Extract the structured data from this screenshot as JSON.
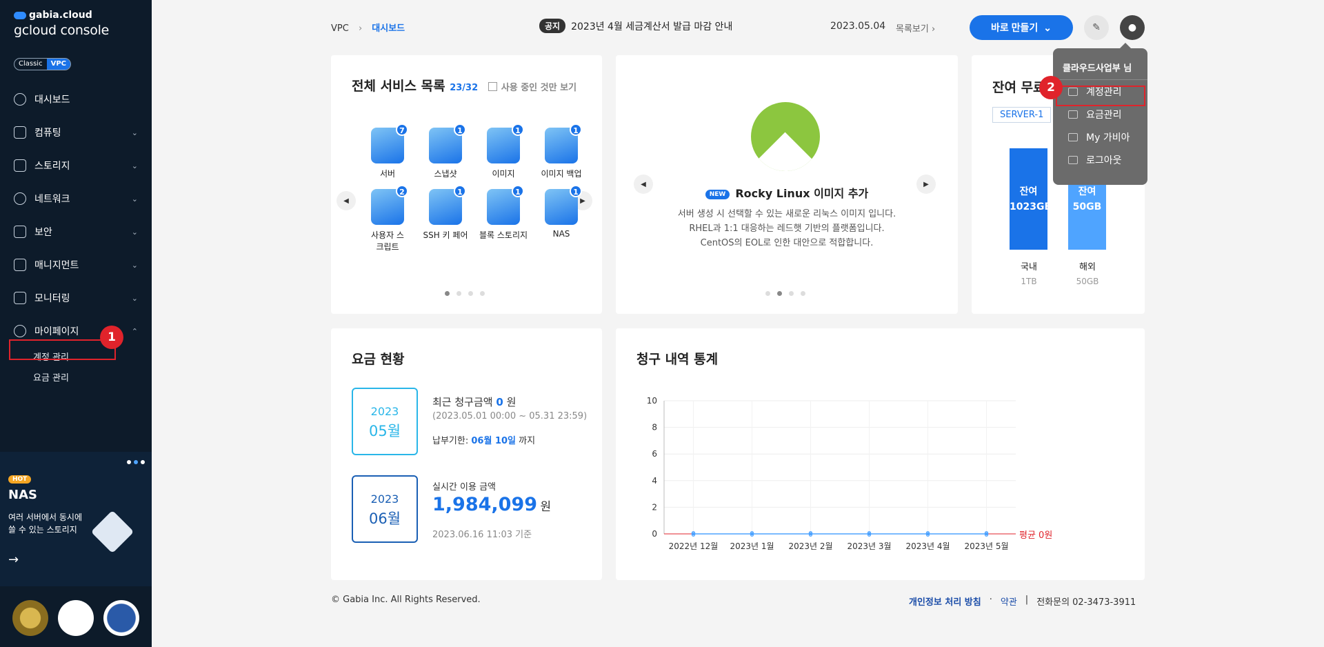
{
  "sidebar": {
    "brand_top": "gabia.cloud",
    "brand_main": "gcloud console",
    "switch": {
      "classic": "Classic",
      "vpc": "VPC"
    },
    "menu": [
      {
        "label": "대시보드"
      },
      {
        "label": "컴퓨팅"
      },
      {
        "label": "스토리지"
      },
      {
        "label": "네트워크"
      },
      {
        "label": "보안"
      },
      {
        "label": "매니지먼트"
      },
      {
        "label": "모니터링"
      },
      {
        "label": "마이페이지"
      }
    ],
    "submenu": [
      "계정 관리",
      "요금 관리"
    ],
    "promo": {
      "tag": "HOT",
      "title": "NAS",
      "desc": "여러 서버에서 동시에 쓸 수 있는 스토리지",
      "arrow": "→"
    }
  },
  "annotations": {
    "one": "1",
    "two": "2"
  },
  "header": {
    "breadcrumb_root": "VPC",
    "breadcrumb_sep": "›",
    "breadcrumb_current": "대시보드",
    "notice_tag": "공지",
    "notice_text": "2023년 4월 세금계산서 발급 마감 안내",
    "notice_date": "2023.05.04",
    "list_view": "목록보기 ›",
    "make_button": "바로 만들기",
    "make_chevron": "⌄"
  },
  "services": {
    "title": "전체 서비스 목록",
    "count": "23/32",
    "filter": "사용 중인 것만 보기",
    "items": [
      {
        "label": "서버",
        "badge": "7"
      },
      {
        "label": "스냅샷",
        "badge": "1"
      },
      {
        "label": "이미지",
        "badge": "1"
      },
      {
        "label": "이미지 백업",
        "badge": "1"
      },
      {
        "label": "사용자 스크립트",
        "badge": "2"
      },
      {
        "label": "SSH 키 페어",
        "badge": "1"
      },
      {
        "label": "블록 스토리지",
        "badge": "1"
      },
      {
        "label": "NAS",
        "badge": "1"
      }
    ]
  },
  "rocky": {
    "new": "NEW",
    "title": "Rocky Linux 이미지 추가",
    "desc1": "서버 생성 시 선택할 수 있는 새로운 리눅스 이미지 입니다.",
    "desc2": "RHEL과 1:1 대응하는 레드햇 기반의 플랫폼입니다.",
    "desc3": "CentOS의 EOL로 인한 대안으로 적합합니다."
  },
  "free": {
    "title": "잔여 무료",
    "server": "SERVER-1",
    "bars": [
      {
        "top": "잔여",
        "value": "1023GB",
        "label": "국내",
        "sub": "1TB"
      },
      {
        "top": "잔여",
        "value": "50GB",
        "label": "해외",
        "sub": "50GB"
      }
    ]
  },
  "dropdown": {
    "user": "클라우드사업부 님",
    "items": [
      "계정관리",
      "요금관리",
      "My 가비아",
      "로그아웃"
    ]
  },
  "fee": {
    "title": "요금 현황",
    "box1": {
      "year": "2023",
      "month": "05월"
    },
    "recent_label": "최근 청구금액",
    "recent_value": "0",
    "recent_unit": "원",
    "recent_period": "(2023.05.01 00:00 ~ 05.31 23:59)",
    "due_label": "납부기한:",
    "due_value": "06월 10일",
    "due_suffix": "까지",
    "box2": {
      "year": "2023",
      "month": "06월"
    },
    "realtime_label": "실시간 이용 금액",
    "realtime_value": "1,984,099",
    "realtime_unit": "원",
    "realtime_basis": "2023.06.16 11:03 기준"
  },
  "billing": {
    "title": "청구 내역 통계",
    "avg_label": "평균 0원"
  },
  "chart_data": {
    "type": "line",
    "categories": [
      "2022년 12월",
      "2023년 1월",
      "2023년 2월",
      "2023년 3월",
      "2023년 4월",
      "2023년 5월"
    ],
    "values": [
      0,
      0,
      0,
      0,
      0,
      0
    ],
    "ylim": [
      0,
      10
    ],
    "yticks": [
      0,
      2,
      4,
      6,
      8,
      10
    ],
    "grid": true,
    "colors": {
      "line": "#4fa4ff",
      "avg": "#e0232b"
    }
  },
  "footer": {
    "copyright": "© Gabia Inc. All Rights Reserved.",
    "privacy": "개인정보 처리 방침",
    "dot": "·",
    "terms": "약관",
    "bar": "|",
    "phone": "전화문의 02-3473-3911"
  }
}
